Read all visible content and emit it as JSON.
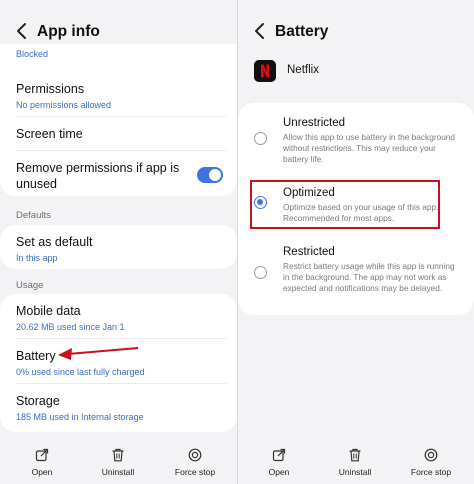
{
  "left": {
    "title": "App info",
    "blocked_text": "Blocked",
    "permissions": {
      "title": "Permissions",
      "sub": "No permissions allowed"
    },
    "screen_time": {
      "title": "Screen time"
    },
    "remove_permissions": {
      "title": "Remove permissions if app is unused",
      "enabled": true
    },
    "defaults_label": "Defaults",
    "set_as_default": {
      "title": "Set as default",
      "sub": "In this app"
    },
    "usage_label": "Usage",
    "mobile_data": {
      "title": "Mobile data",
      "sub": "20.62 MB used since Jan 1"
    },
    "battery": {
      "title": "Battery",
      "sub": "0% used since last fully charged"
    },
    "storage": {
      "title": "Storage",
      "sub": "185 MB used in Internal storage"
    },
    "bottom_bar": {
      "open": "Open",
      "uninstall": "Uninstall",
      "force_stop": "Force stop"
    }
  },
  "right": {
    "title": "Battery",
    "app_name": "Netflix",
    "options": [
      {
        "title": "Unrestricted",
        "desc": "Allow this app to use battery in the background without restrictions. This may reduce your battery life.",
        "selected": false
      },
      {
        "title": "Optimized",
        "desc": "Optimize based on your usage of this app. Recommended for most apps.",
        "selected": true
      },
      {
        "title": "Restricted",
        "desc": "Restrict battery usage while this app is running in the background. The app may not work as expected and notifications may be delayed.",
        "selected": false
      }
    ],
    "bottom_bar": {
      "open": "Open",
      "uninstall": "Uninstall",
      "force_stop": "Force stop"
    }
  },
  "colors": {
    "accent": "#3e73e0",
    "link_text": "#3b6bc9",
    "highlight_box": "#c8101e",
    "annotation_arrow": "#c8101e",
    "netflix_red": "#e50914"
  }
}
